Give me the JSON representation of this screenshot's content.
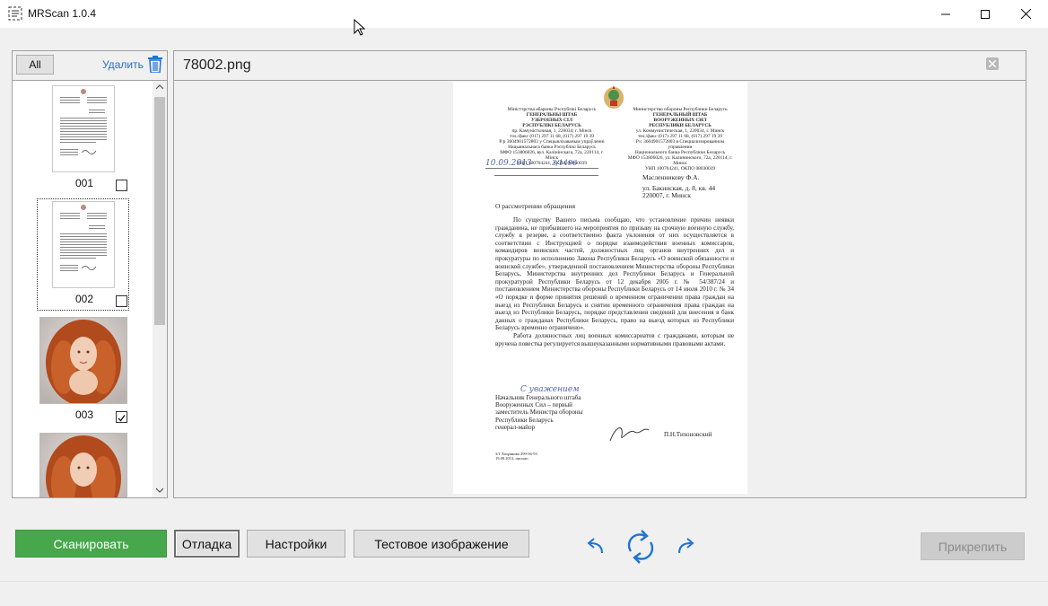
{
  "window": {
    "title": "MRScan 1.0.4"
  },
  "left_panel": {
    "all_button": "All",
    "delete_label": "Удалить",
    "thumbnails": [
      {
        "label": "001",
        "type": "document",
        "checked": false
      },
      {
        "label": "002",
        "type": "document",
        "checked": false,
        "selected": true
      },
      {
        "label": "003",
        "type": "photo",
        "checked": true
      },
      {
        "label": "",
        "type": "photo",
        "checked": false
      }
    ]
  },
  "preview": {
    "filename": "78002.png",
    "document": {
      "header_left": [
        "Міністэрства абароны Рэспублікі Беларусь",
        "ГЕНЕРАЛЬНЫ ШТАБ",
        "УЗБРОЕНЫХ СІЛ",
        "РЭСПУБЛІКІ БЕЛАРУСЬ"
      ],
      "header_right": [
        "Министерство обороны Республики Беларусь",
        "ГЕНЕРАЛЬНЫЙ ШТАБ",
        "ВООРУЖЕННЫХ СИЛ",
        "РЕСПУБЛИКИ БЕЛАРУСЬ"
      ],
      "handwritten_date": "10.09.2013",
      "handwritten_number": "3/1496",
      "recipient": [
        "Масленникову Ф.А.",
        "ул. Бакинская, д. 8, кв. 44",
        "220007, г. Минск"
      ],
      "subject": "О рассмотрении обращения",
      "body_p1": "По существу Вашего письма сообщаю, что установление причин неявки гражданина, не прибывшего на мероприятия по призыву на срочную военную службу, службу в резерве, а соответственно факта уклонения от них осуществляется в соответствии с Инструкцией о порядке взаимодействия военных комиссаров, командиров воинских частей, должностных лиц органов внутренних дел и прокуратуры по исполнению Закона Республики Беларусь «О воинской обязанности и воинской службе», утвержденной постановлением Министерства обороны Республики Беларусь, Министерства внутренних дел Республики Беларусь и Генеральной прокуратурой Республики Беларусь от 12 декабря 2005 г. № 54/387/24 и постановлением Министерства обороны Республики Беларусь от 14 июля 2010 г. № 34 «О порядке и форме принятия решений о временном ограничении права граждан на выезд из Республики Беларусь и снятии временного ограничения права граждан на выезд из Республики Беларусь, порядке представления сведений для внесения в банк данных о гражданах Республики Беларусь, право на выезд которых из Республики Беларусь временно ограничено».",
      "body_p2": "Работа должностных лиц военных комиссариатов с гражданами, которым не вручена повестка регулируется вышеуказанными нормативными правовыми актами.",
      "handwritten_closing": "С уважением",
      "signature_block": [
        "Начальник Генерального штаба",
        "Вооруженных Сил – первый",
        "заместитель Министра обороны",
        "Республики Беларусь",
        "генерал-майор"
      ],
      "signer": "П.Н.Тихоновский"
    }
  },
  "buttons": {
    "scan": "Сканировать",
    "debug": "Отладка",
    "settings": "Настройки",
    "test_image": "Тестовое изображение",
    "attach": "Прикрепить"
  },
  "colors": {
    "scan_button": "#46a84b",
    "accent_blue": "#1e73d2"
  }
}
